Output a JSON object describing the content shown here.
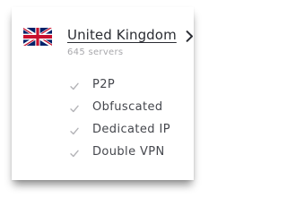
{
  "location": {
    "country_name": "United Kingdom",
    "flag_icon": "uk-flag-icon",
    "chevron_icon": "chevron-right-icon",
    "server_count": "645 servers"
  },
  "features": [
    {
      "label": "P2P",
      "icon": "check-icon"
    },
    {
      "label": "Obfuscated",
      "icon": "check-icon"
    },
    {
      "label": "Dedicated IP",
      "icon": "check-icon"
    },
    {
      "label": "Double VPN",
      "icon": "check-icon"
    }
  ],
  "colors": {
    "text_primary": "#2b2d33",
    "text_secondary": "#a8a8ac",
    "check": "#b4b4b8",
    "flag_blue": "#012169",
    "flag_red": "#C8102E"
  }
}
